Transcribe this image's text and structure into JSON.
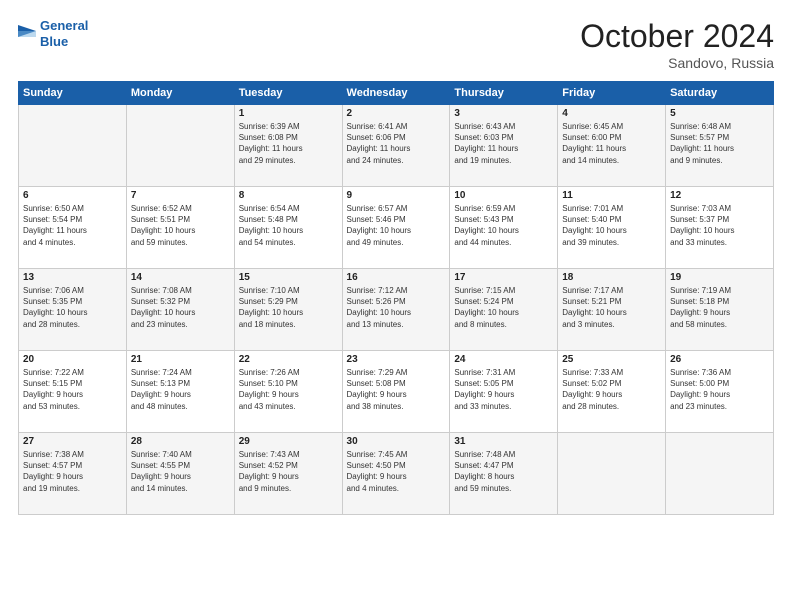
{
  "header": {
    "logo_line1": "General",
    "logo_line2": "Blue",
    "month": "October 2024",
    "location": "Sandovo, Russia"
  },
  "days_of_week": [
    "Sunday",
    "Monday",
    "Tuesday",
    "Wednesday",
    "Thursday",
    "Friday",
    "Saturday"
  ],
  "weeks": [
    [
      {
        "day": "",
        "detail": ""
      },
      {
        "day": "",
        "detail": ""
      },
      {
        "day": "1",
        "detail": "Sunrise: 6:39 AM\nSunset: 6:08 PM\nDaylight: 11 hours\nand 29 minutes."
      },
      {
        "day": "2",
        "detail": "Sunrise: 6:41 AM\nSunset: 6:06 PM\nDaylight: 11 hours\nand 24 minutes."
      },
      {
        "day": "3",
        "detail": "Sunrise: 6:43 AM\nSunset: 6:03 PM\nDaylight: 11 hours\nand 19 minutes."
      },
      {
        "day": "4",
        "detail": "Sunrise: 6:45 AM\nSunset: 6:00 PM\nDaylight: 11 hours\nand 14 minutes."
      },
      {
        "day": "5",
        "detail": "Sunrise: 6:48 AM\nSunset: 5:57 PM\nDaylight: 11 hours\nand 9 minutes."
      }
    ],
    [
      {
        "day": "6",
        "detail": "Sunrise: 6:50 AM\nSunset: 5:54 PM\nDaylight: 11 hours\nand 4 minutes."
      },
      {
        "day": "7",
        "detail": "Sunrise: 6:52 AM\nSunset: 5:51 PM\nDaylight: 10 hours\nand 59 minutes."
      },
      {
        "day": "8",
        "detail": "Sunrise: 6:54 AM\nSunset: 5:48 PM\nDaylight: 10 hours\nand 54 minutes."
      },
      {
        "day": "9",
        "detail": "Sunrise: 6:57 AM\nSunset: 5:46 PM\nDaylight: 10 hours\nand 49 minutes."
      },
      {
        "day": "10",
        "detail": "Sunrise: 6:59 AM\nSunset: 5:43 PM\nDaylight: 10 hours\nand 44 minutes."
      },
      {
        "day": "11",
        "detail": "Sunrise: 7:01 AM\nSunset: 5:40 PM\nDaylight: 10 hours\nand 39 minutes."
      },
      {
        "day": "12",
        "detail": "Sunrise: 7:03 AM\nSunset: 5:37 PM\nDaylight: 10 hours\nand 33 minutes."
      }
    ],
    [
      {
        "day": "13",
        "detail": "Sunrise: 7:06 AM\nSunset: 5:35 PM\nDaylight: 10 hours\nand 28 minutes."
      },
      {
        "day": "14",
        "detail": "Sunrise: 7:08 AM\nSunset: 5:32 PM\nDaylight: 10 hours\nand 23 minutes."
      },
      {
        "day": "15",
        "detail": "Sunrise: 7:10 AM\nSunset: 5:29 PM\nDaylight: 10 hours\nand 18 minutes."
      },
      {
        "day": "16",
        "detail": "Sunrise: 7:12 AM\nSunset: 5:26 PM\nDaylight: 10 hours\nand 13 minutes."
      },
      {
        "day": "17",
        "detail": "Sunrise: 7:15 AM\nSunset: 5:24 PM\nDaylight: 10 hours\nand 8 minutes."
      },
      {
        "day": "18",
        "detail": "Sunrise: 7:17 AM\nSunset: 5:21 PM\nDaylight: 10 hours\nand 3 minutes."
      },
      {
        "day": "19",
        "detail": "Sunrise: 7:19 AM\nSunset: 5:18 PM\nDaylight: 9 hours\nand 58 minutes."
      }
    ],
    [
      {
        "day": "20",
        "detail": "Sunrise: 7:22 AM\nSunset: 5:15 PM\nDaylight: 9 hours\nand 53 minutes."
      },
      {
        "day": "21",
        "detail": "Sunrise: 7:24 AM\nSunset: 5:13 PM\nDaylight: 9 hours\nand 48 minutes."
      },
      {
        "day": "22",
        "detail": "Sunrise: 7:26 AM\nSunset: 5:10 PM\nDaylight: 9 hours\nand 43 minutes."
      },
      {
        "day": "23",
        "detail": "Sunrise: 7:29 AM\nSunset: 5:08 PM\nDaylight: 9 hours\nand 38 minutes."
      },
      {
        "day": "24",
        "detail": "Sunrise: 7:31 AM\nSunset: 5:05 PM\nDaylight: 9 hours\nand 33 minutes."
      },
      {
        "day": "25",
        "detail": "Sunrise: 7:33 AM\nSunset: 5:02 PM\nDaylight: 9 hours\nand 28 minutes."
      },
      {
        "day": "26",
        "detail": "Sunrise: 7:36 AM\nSunset: 5:00 PM\nDaylight: 9 hours\nand 23 minutes."
      }
    ],
    [
      {
        "day": "27",
        "detail": "Sunrise: 7:38 AM\nSunset: 4:57 PM\nDaylight: 9 hours\nand 19 minutes."
      },
      {
        "day": "28",
        "detail": "Sunrise: 7:40 AM\nSunset: 4:55 PM\nDaylight: 9 hours\nand 14 minutes."
      },
      {
        "day": "29",
        "detail": "Sunrise: 7:43 AM\nSunset: 4:52 PM\nDaylight: 9 hours\nand 9 minutes."
      },
      {
        "day": "30",
        "detail": "Sunrise: 7:45 AM\nSunset: 4:50 PM\nDaylight: 9 hours\nand 4 minutes."
      },
      {
        "day": "31",
        "detail": "Sunrise: 7:48 AM\nSunset: 4:47 PM\nDaylight: 8 hours\nand 59 minutes."
      },
      {
        "day": "",
        "detail": ""
      },
      {
        "day": "",
        "detail": ""
      }
    ]
  ]
}
